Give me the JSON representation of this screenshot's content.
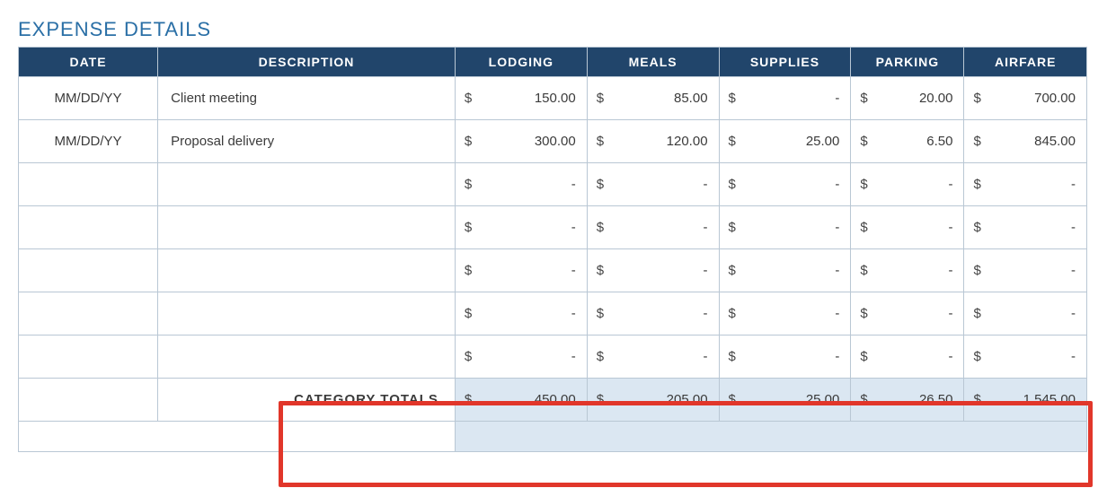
{
  "title": "EXPENSE DETAILS",
  "headers": {
    "date": "DATE",
    "description": "DESCRIPTION",
    "lodging": "LODGING",
    "meals": "MEALS",
    "supplies": "SUPPLIES",
    "parking": "PARKING",
    "airfare": "AIRFARE"
  },
  "currency": "$",
  "dash": "-",
  "rows": [
    {
      "date": "MM/DD/YY",
      "description": "Client meeting",
      "lodging": "150.00",
      "meals": "85.00",
      "supplies": "-",
      "parking": "20.00",
      "airfare": "700.00"
    },
    {
      "date": "MM/DD/YY",
      "description": "Proposal delivery",
      "lodging": "300.00",
      "meals": "120.00",
      "supplies": "25.00",
      "parking": "6.50",
      "airfare": "845.00"
    },
    {
      "date": "",
      "description": "",
      "lodging": "-",
      "meals": "-",
      "supplies": "-",
      "parking": "-",
      "airfare": "-"
    },
    {
      "date": "",
      "description": "",
      "lodging": "-",
      "meals": "-",
      "supplies": "-",
      "parking": "-",
      "airfare": "-"
    },
    {
      "date": "",
      "description": "",
      "lodging": "-",
      "meals": "-",
      "supplies": "-",
      "parking": "-",
      "airfare": "-"
    },
    {
      "date": "",
      "description": "",
      "lodging": "-",
      "meals": "-",
      "supplies": "-",
      "parking": "-",
      "airfare": "-"
    },
    {
      "date": "",
      "description": "",
      "lodging": "-",
      "meals": "-",
      "supplies": "-",
      "parking": "-",
      "airfare": "-"
    }
  ],
  "totals": {
    "label": "CATEGORY TOTALS",
    "lodging": "450.00",
    "meals": "205.00",
    "supplies": "25.00",
    "parking": "26.50",
    "airfare": "1,545.00"
  }
}
